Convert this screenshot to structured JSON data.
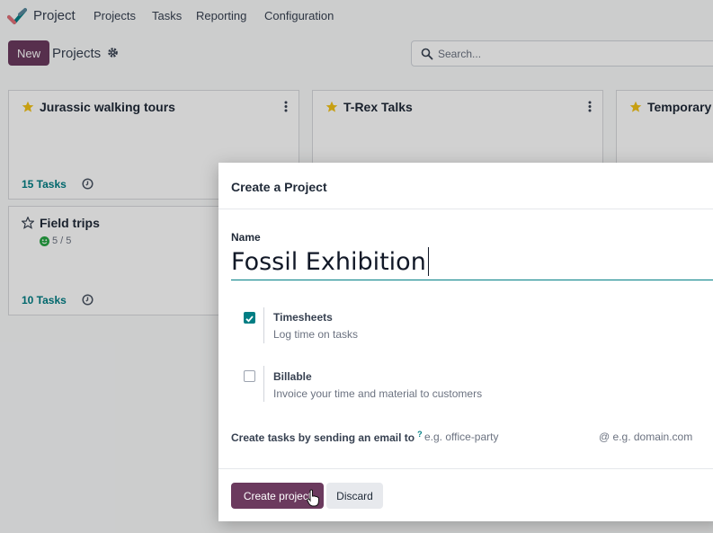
{
  "topnav": {
    "app_title": "Project",
    "items": [
      "Projects",
      "Tasks",
      "Reporting",
      "Configuration"
    ]
  },
  "control_panel": {
    "new_label": "New",
    "breadcrumb": "Projects",
    "search_placeholder": "Search..."
  },
  "cards": [
    {
      "title": "Jurassic walking tours",
      "starred": true,
      "tasks": "15 Tasks"
    },
    {
      "title": "T-Rex Talks",
      "starred": true
    },
    {
      "title": "Temporary",
      "starred": true
    },
    {
      "title": "Field trips",
      "starred": false,
      "rating": "5 / 5",
      "tasks": "10 Tasks"
    }
  ],
  "modal": {
    "title": "Create a Project",
    "name_label": "Name",
    "name_value": "Fossil Exhibition",
    "options": [
      {
        "title": "Timesheets",
        "description": "Log time on tasks",
        "checked": true
      },
      {
        "title": "Billable",
        "description": "Invoice your time and material to customers",
        "checked": false
      }
    ],
    "alias_label": "Create tasks by sending an email to",
    "alias_help": "?",
    "alias_placeholder": "e.g. office-party",
    "alias_domain": "@ e.g. domain.com",
    "create_label": "Create project",
    "discard_label": "Discard"
  },
  "colors": {
    "primary": "#6b3a5e",
    "accent": "#017e84",
    "star": "#f3c316"
  }
}
